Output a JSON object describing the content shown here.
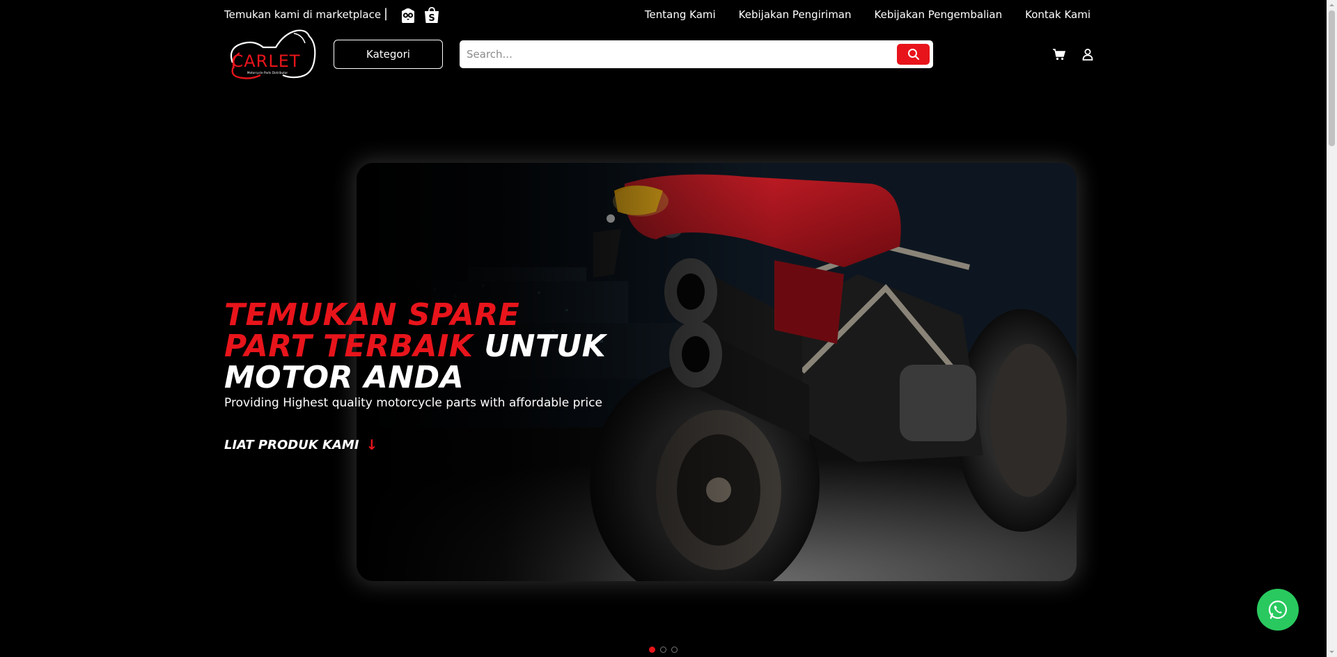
{
  "topbar": {
    "marketplace_text": "Temukan kami di marketplace",
    "separator": "|",
    "marketplaces": [
      "tokopedia-icon",
      "shopee-icon"
    ],
    "links": [
      "Tentang Kami",
      "Kebijakan Pengiriman",
      "Kebijakan Pengembalian",
      "Kontak Kami"
    ]
  },
  "header": {
    "logo_text": "CARLET",
    "logo_tagline": "Motorcycle Parts Distributor",
    "kategori_label": "Kategori",
    "search_placeholder": "Search...",
    "icons": [
      "search-icon",
      "cart-icon",
      "user-icon"
    ]
  },
  "hero": {
    "headline_red_1": "TEMUKAN SPARE",
    "headline_red_2": "PART TERBAIK",
    "headline_white_1": "UNTUK",
    "headline_white_2": "MOTOR ANDA",
    "subline": "Providing Highest quality motorcycle parts with affordable price",
    "cta_label": "LIAT PRODUK KAMI",
    "cta_arrow": "↓",
    "slide_count": 3,
    "active_slide": 1
  },
  "colors": {
    "accent": "#e8141b",
    "background": "#000000",
    "whatsapp": "#29c95f"
  },
  "floating": {
    "icon": "whatsapp-icon"
  }
}
